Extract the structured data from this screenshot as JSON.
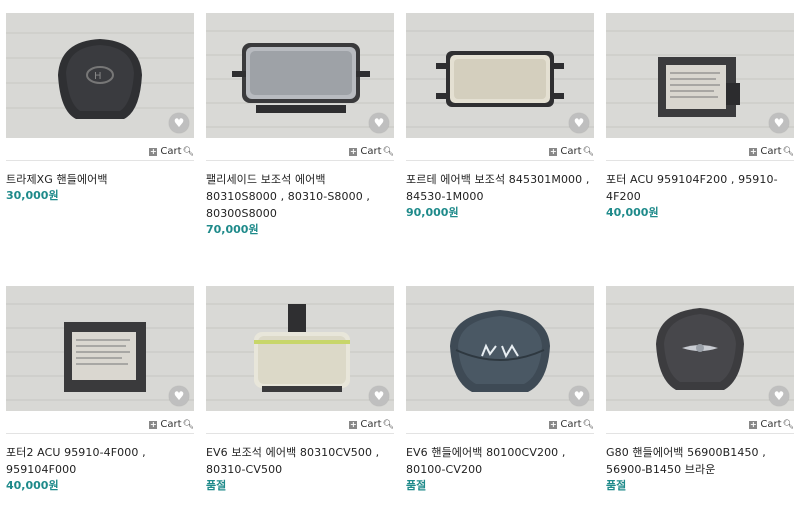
{
  "cart_label": "Cart",
  "products": [
    {
      "title": "트라제XG 핸들에어백",
      "price": "30,000원"
    },
    {
      "title": "팰리세이드 보조석 에어백 80310S8000 , 80310-S8000 , 80300S8000",
      "price": "70,000원"
    },
    {
      "title": "포르테 에어백 보조석 845301M000 , 84530-1M000",
      "price": "90,000원"
    },
    {
      "title": "포터 ACU 959104F200 , 95910-4F200",
      "price": "40,000원"
    },
    {
      "title": "포터2 ACU 95910-4F000 , 959104F000",
      "price": "40,000원"
    },
    {
      "title": "EV6 보조석 에어백 80310CV500 , 80310-CV500",
      "price": "품절"
    },
    {
      "title": "EV6 핸들에어백 80100CV200 , 80100-CV200",
      "price": "품절"
    },
    {
      "title": "G80 핸들에어백 56900B1450 , 56900-B1450 브라운",
      "price": "품절"
    }
  ]
}
